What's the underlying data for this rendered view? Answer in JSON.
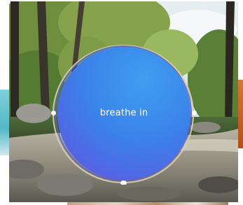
{
  "breathing_exercise": {
    "prompt_text": "breathe in",
    "orb_color_top": "#3f9ef0",
    "orb_color_bottom": "#6e4fe0",
    "ring_color": "#d6ceb4"
  },
  "background": {
    "scene": "forest-river-photo"
  },
  "adjacent_cards": {
    "left_color": "#7fd0d9",
    "right_color": "#c0561c"
  }
}
